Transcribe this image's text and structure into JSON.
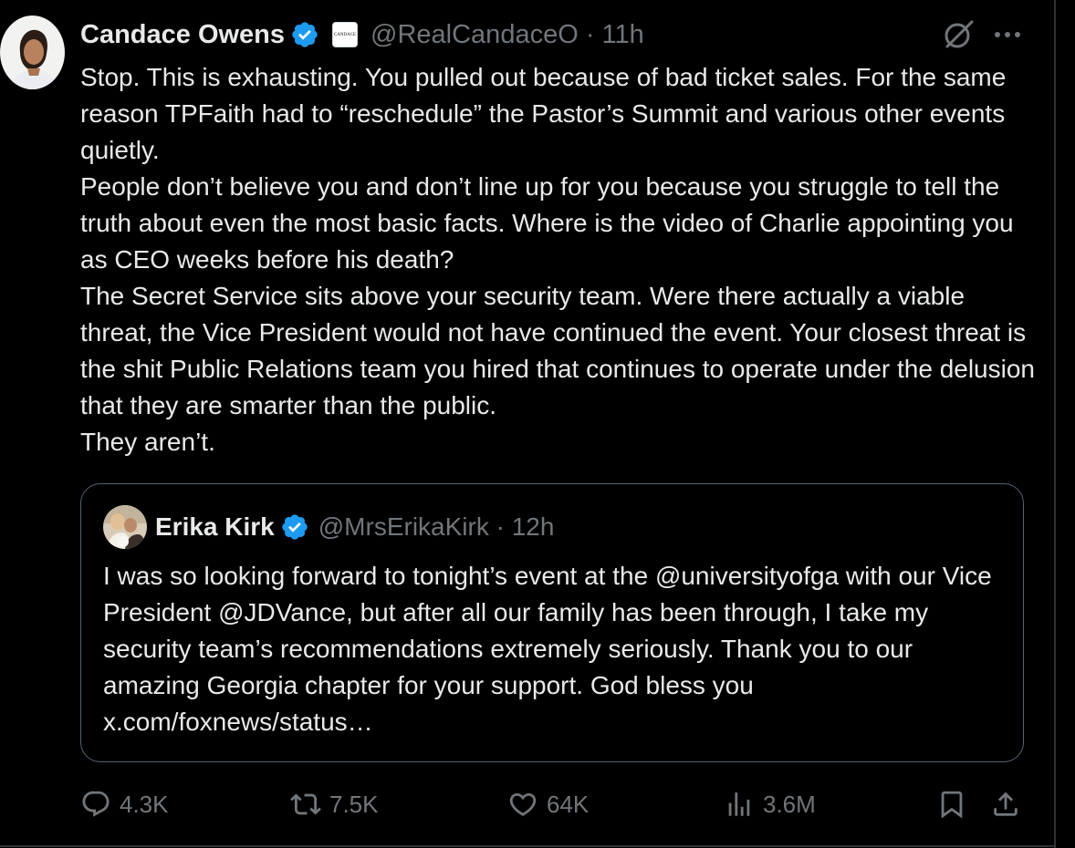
{
  "tweet": {
    "author": {
      "display_name": "Candace Owens",
      "handle": "@RealCandaceO",
      "time": "11h",
      "affiliate_badge_text": "CANDACE"
    },
    "paragraphs": [
      "Stop. This is exhausting. You pulled out because of bad ticket sales. For the same reason TPFaith had to “reschedule” the Pastor’s Summit and various other events quietly.",
      "People don’t believe you and don’t line up for you because you struggle to tell the truth about even the most basic facts. Where is the video of Charlie appointing you as CEO weeks before his death?",
      "The Secret Service sits above your security team. Were there actually a viable threat, the Vice President would not have continued the event. Your closest threat is the shit Public Relations team you hired that continues to operate under the delusion that they are smarter than the public.",
      "They aren’t."
    ],
    "quote": {
      "display_name": "Erika Kirk",
      "handle": "@MrsErikaKirk",
      "time": "12h",
      "text": "I was so looking forward to tonight’s event at the @universityofga with our Vice President @JDVance, but after all our family has been through, I take my security team’s recommendations extremely seriously. Thank you to our amazing Georgia chapter for your support. God bless you x.com/foxnews/status…"
    },
    "stats": {
      "replies": "4.3K",
      "reposts": "7.5K",
      "likes": "64K",
      "views": "3.6M"
    }
  },
  "icons": {
    "verified": "verified-badge-icon",
    "grok": "grok-icon",
    "more": "more-options-icon",
    "reply": "reply-icon",
    "repost": "repost-icon",
    "like": "heart-icon",
    "views": "views-icon",
    "bookmark": "bookmark-icon",
    "share": "share-icon"
  },
  "colors": {
    "background": "#000000",
    "text": "#e7e9ea",
    "muted": "#71767b",
    "verified": "#1d9bf0",
    "border": "#536471"
  }
}
